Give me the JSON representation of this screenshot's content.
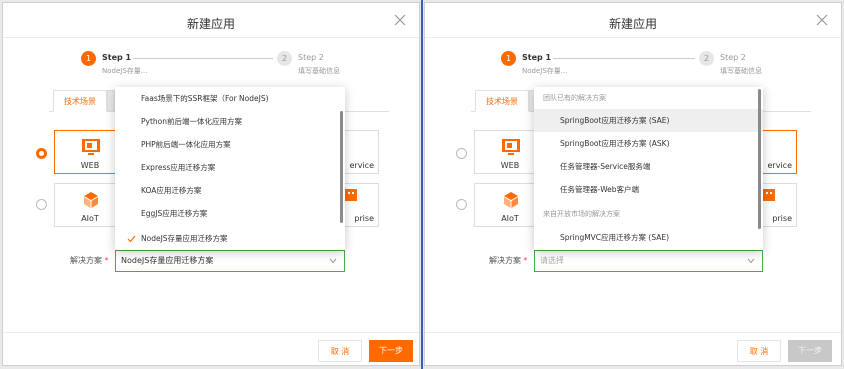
{
  "dialog_title": "新建应用",
  "steps": [
    {
      "num": "1",
      "title": "Step 1",
      "desc": "NodeJS存量..."
    },
    {
      "num": "2",
      "title": "Step 2",
      "desc": "填写基础信息"
    }
  ],
  "tab_label": "技术场景",
  "cards": {
    "web": "WEB",
    "aiot": "AIoT",
    "service": "ervice",
    "enterprise": "prise"
  },
  "field_label": "解决方案",
  "required_mark": "*",
  "left": {
    "select_value": "NodeJS存量应用迁移方案",
    "dropdown_items": [
      "Faas场景下的SSR框架（For NodeJS)",
      "Python前后端一体化应用方案",
      "PHP前后端一体化应用方案",
      "Express应用迁移方案",
      "KOA应用迁移方案",
      "EggJS应用迁移方案",
      "NodeJS存量应用迁移方案"
    ],
    "selected_index": 6
  },
  "right": {
    "select_placeholder": "请选择",
    "group1": "团队已有的解决方案",
    "group1_items": [
      "SpringBoot应用迁移方案 (SAE)",
      "SpringBoot应用迁移方案 (ASK)",
      "任务管理器-Service服务端",
      "任务管理器-Web客户端"
    ],
    "group2": "来自开放市场的解决方案",
    "group2_items": [
      "SpringMVC应用迁移方案 (SAE)"
    ],
    "highlight_index": 0
  },
  "buttons": {
    "cancel": "取 消",
    "next": "下一步"
  },
  "colors": {
    "accent": "#ff6a00",
    "select_border": "#4ca84c",
    "required": "#ff3b30"
  }
}
